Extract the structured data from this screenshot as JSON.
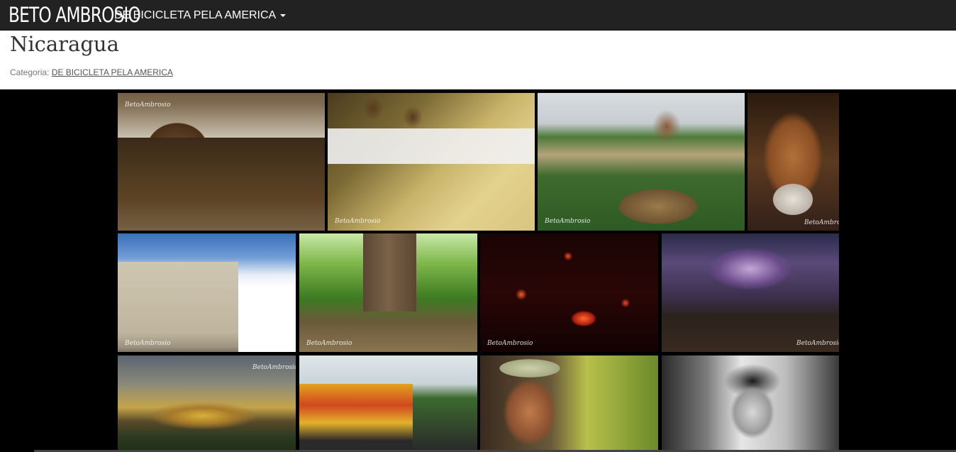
{
  "navbar": {
    "brand": "BETO AMBROSIO",
    "menu_label": "DE BICICLETA PELA AMERICA"
  },
  "page": {
    "title": "Nicaragua",
    "category_prefix": "Categoria:",
    "category_link": "DE BICICLETA PELA AMERICA"
  },
  "gallery": {
    "watermark": "BetoAmbrosio",
    "photos": [
      {
        "name": "photo-girls-smiling"
      },
      {
        "name": "photo-two-boys"
      },
      {
        "name": "photo-farmer-with-sticks"
      },
      {
        "name": "photo-old-man-portrait"
      },
      {
        "name": "photo-leon-cathedral"
      },
      {
        "name": "photo-giant-tree"
      },
      {
        "name": "photo-lava-night"
      },
      {
        "name": "photo-volcano-lightning"
      },
      {
        "name": "photo-volcano-sunset"
      },
      {
        "name": "photo-chicken-bus"
      },
      {
        "name": "photo-man-in-cap"
      },
      {
        "name": "photo-boy-black-white"
      }
    ]
  }
}
